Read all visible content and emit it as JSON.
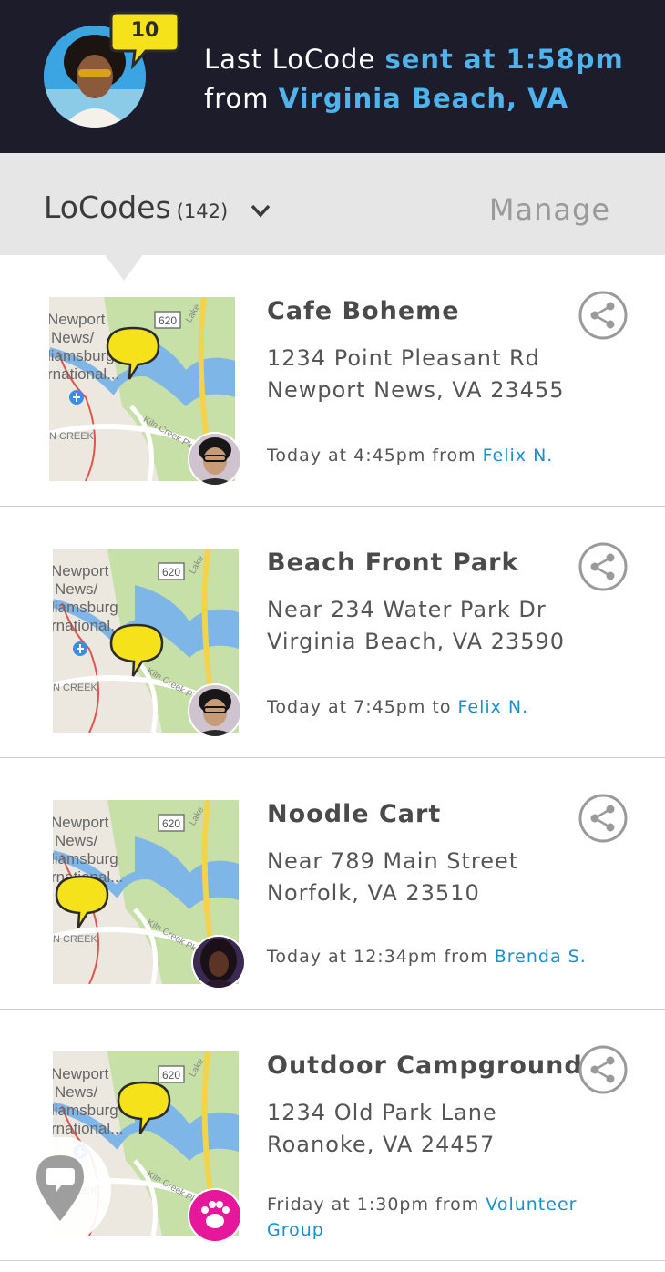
{
  "header": {
    "badge_count": "10",
    "line1_prefix": "Last LoCode ",
    "line1_highlight": "sent at 1:58pm",
    "line2_prefix": "from ",
    "line2_highlight": "Virginia Beach, VA"
  },
  "subheader": {
    "title": "LoCodes",
    "count": "(142)",
    "manage_label": "Manage"
  },
  "map_labels": {
    "line1": "Newport",
    "line2": "News/",
    "line3": "liamsburg",
    "line4": "rnational...",
    "road": "620",
    "creek": "N CREEK",
    "parkway": "Kiln Creek Pkwy",
    "lake": "Lake"
  },
  "items": [
    {
      "title": "Cafe Boheme",
      "address_line1": "1234 Point Pleasant Rd",
      "address_line2": "Newport News, VA 23455",
      "meta_prefix": "Today at 4:45pm from ",
      "meta_link": "Felix N."
    },
    {
      "title": "Beach Front Park",
      "address_line1": "Near 234 Water Park Dr",
      "address_line2": "Virginia Beach, VA 23590",
      "meta_prefix": "Today at 7:45pm to ",
      "meta_link": "Felix N."
    },
    {
      "title": "Noodle Cart",
      "address_line1": "Near 789 Main Street",
      "address_line2": "Norfolk, VA 23510",
      "meta_prefix": "Today at 12:34pm from ",
      "meta_link": "Brenda S."
    },
    {
      "title": "Outdoor Campground",
      "address_line1": "1234 Old Park Lane",
      "address_line2": "Roanoke, VA 24457",
      "meta_prefix": "Friday at 1:30pm from ",
      "meta_link": "Volunteer Group"
    }
  ],
  "colors": {
    "header_bg": "#1c1c2b",
    "accent": "#4fb4ee",
    "link": "#1a8fd0",
    "pin_yellow": "#f5e21b",
    "group_pink": "#e6179a"
  },
  "icons": [
    "share-icon",
    "chevron-down-icon",
    "map-pin-icon",
    "paw-icon",
    "airport-icon"
  ]
}
